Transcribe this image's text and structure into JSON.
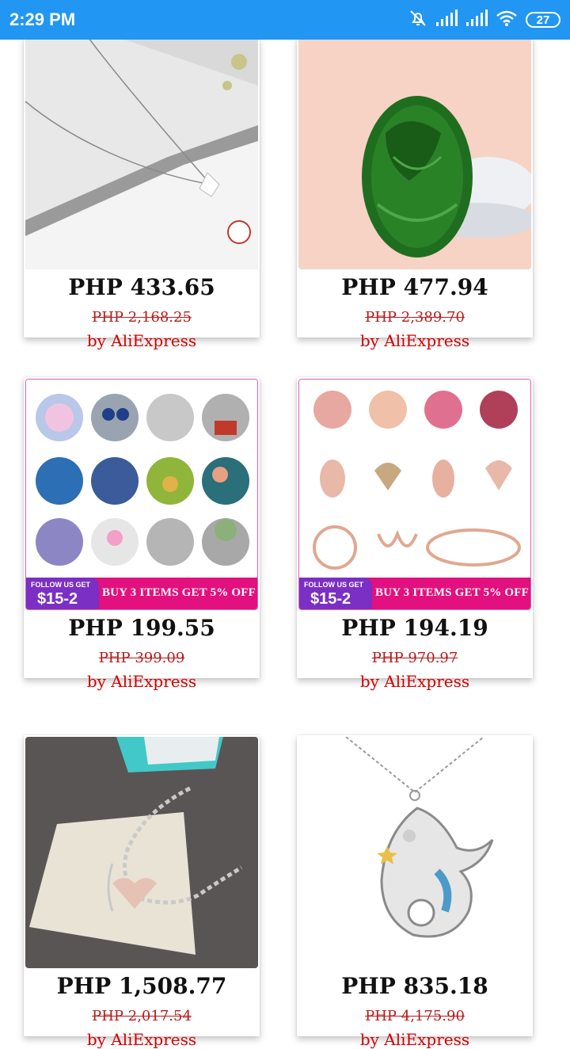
{
  "status_bar": {
    "time": "2:29 PM",
    "battery": "27",
    "icons": [
      "bell-off-icon",
      "signal-icon",
      "signal-icon",
      "wifi-icon",
      "battery-icon"
    ]
  },
  "products": [
    {
      "price": "PHP 433.65",
      "old_price": "PHP 2,168.25",
      "seller": "by AliExpress",
      "image": "silver ginkgo leaf necklace"
    },
    {
      "price": "PHP 477.94",
      "old_price": "PHP 2,389.70",
      "seller": "by AliExpress",
      "image": "green jade carved pendant"
    },
    {
      "price": "PHP 199.55",
      "old_price": "PHP 399.09",
      "seller": "by AliExpress",
      "image": "assorted silver charm beads",
      "promo": {
        "follow": "FOLLOW US GET",
        "amount": "$15-2",
        "offer": "BUY 3 ITEMS GET 5% OFF"
      }
    },
    {
      "price": "PHP 194.19",
      "old_price": "PHP 970.97",
      "seller": "by AliExpress",
      "image": "rose gold charms and bracelet",
      "promo": {
        "follow": "FOLLOW US GET",
        "amount": "$15-2",
        "offer": "BUY 3 ITEMS GET 5% OFF"
      }
    },
    {
      "price": "PHP 1,508.77",
      "old_price": "PHP 2,017.54",
      "seller": "by AliExpress",
      "image": "silver heart chain bracelet"
    },
    {
      "price": "PHP 835.18",
      "old_price": "PHP 4,175.90",
      "seller": "by AliExpress",
      "image": "mermaid pendant necklace"
    }
  ]
}
